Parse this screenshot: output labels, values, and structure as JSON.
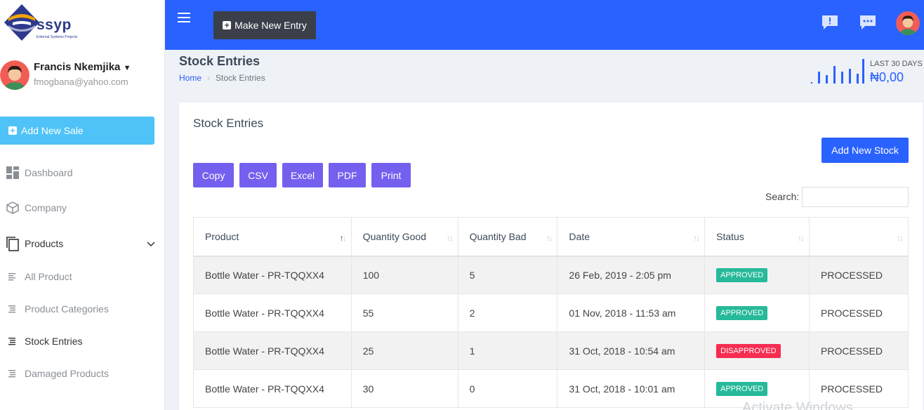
{
  "sidebar": {
    "logo_text": "ssyp",
    "logo_sub": "External Systems Projects",
    "user_name": "Francis Nkemjika",
    "user_email": "fmogbana@yahoo.com",
    "add_sale_label": "Add New Sale",
    "items": [
      {
        "label": "Dashboard",
        "icon": "dashboard-icon"
      },
      {
        "label": "Company",
        "icon": "cube-icon"
      },
      {
        "label": "Products",
        "icon": "copy-icon"
      },
      {
        "label": "All Product",
        "icon": "list-icon"
      },
      {
        "label": "Product Categories",
        "icon": "list-icon"
      },
      {
        "label": "Stock Entries",
        "icon": "list-icon"
      },
      {
        "label": "Damaged Products",
        "icon": "list-icon"
      }
    ]
  },
  "topbar": {
    "make_entry_label": "Make New Entry"
  },
  "header": {
    "title": "Stock Entries",
    "breadcrumb_home": "Home",
    "breadcrumb_current": "Stock Entries",
    "stat_label": "LAST 30 DAYS",
    "stat_value": "₦0,00"
  },
  "card": {
    "title": "Stock Entries",
    "add_stock_label": "Add New Stock",
    "export_buttons": [
      "Copy",
      "CSV",
      "Excel",
      "PDF",
      "Print"
    ],
    "search_label": "Search:"
  },
  "table": {
    "columns": [
      "Product",
      "Quantity Good",
      "Quantity Bad",
      "Date",
      "Status",
      ""
    ],
    "rows": [
      {
        "product": "Bottle Water - PR-TQQXX4",
        "good": "100",
        "bad": "5",
        "date": "26 Feb, 2019 - 2:05 pm",
        "status": "APPROVED",
        "action": "PROCESSED"
      },
      {
        "product": "Bottle Water - PR-TQQXX4",
        "good": "55",
        "bad": "2",
        "date": "01 Nov, 2018 - 11:53 am",
        "status": "APPROVED",
        "action": "PROCESSED"
      },
      {
        "product": "Bottle Water - PR-TQQXX4",
        "good": "25",
        "bad": "1",
        "date": "31 Oct, 2018 - 10:54 am",
        "status": "DISAPPROVED",
        "action": "PROCESSED"
      },
      {
        "product": "Bottle Water - PR-TQQXX4",
        "good": "30",
        "bad": "0",
        "date": "31 Oct, 2018 - 10:01 am",
        "status": "APPROVED",
        "action": "PROCESSED"
      }
    ]
  },
  "watermark": "Activate Windows",
  "colors": {
    "topbar": "#2962ff",
    "add_sale": "#4fc3f7",
    "export_button": "#7460ee",
    "approved": "#26b99a",
    "disapproved": "#f62d51"
  }
}
